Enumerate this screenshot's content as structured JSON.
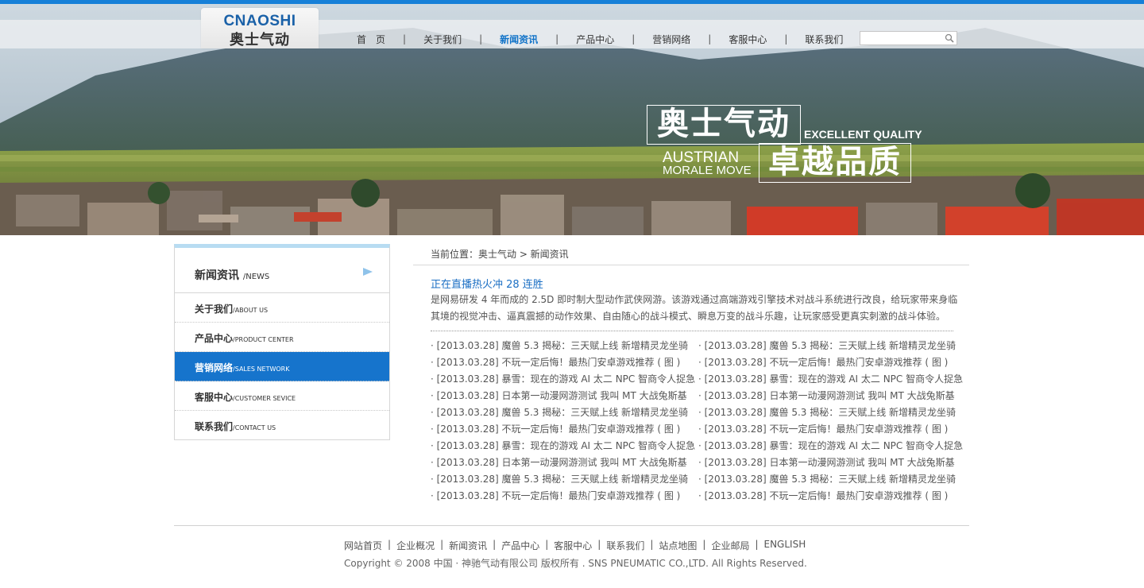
{
  "logo": {
    "en": "CNAOSHI",
    "cn": "奥士气动"
  },
  "nav": {
    "items": [
      "首　页",
      "关于我们",
      "新闻资讯",
      "产品中心",
      "营销网络",
      "客服中心",
      "联系我们"
    ],
    "active_index": 2,
    "separator": "|"
  },
  "search": {
    "placeholder": ""
  },
  "banner": {
    "cn_line1": "奥士气动",
    "cn_line2": "卓越品质",
    "en_line1": "EXCELLENT QUALITY",
    "en_line2": "AUSTRIAN",
    "en_line3": "MORALE MOVE"
  },
  "sidebar": {
    "title": "新闻资讯",
    "title_en": "/NEWS",
    "items": [
      {
        "label": "关于我们",
        "en": "/ABOUT US"
      },
      {
        "label": "产品中心",
        "en": "/PRODUCT CENTER"
      },
      {
        "label": "营销网络",
        "en": "/SALES NETWORK"
      },
      {
        "label": "客服中心",
        "en": "/CUSTOMER SEVICE"
      },
      {
        "label": "联系我们",
        "en": "/CONTACT US"
      }
    ],
    "active_index": 2
  },
  "breadcrumb": "当前位置：奥士气动 > 新闻资讯",
  "article": {
    "title": "正在直播热火冲 28 连胜",
    "description": "是网易研发 4 年而成的 2.5D 即时制大型动作武侠网游。该游戏通过高端游戏引擎技术对战斗系统进行改良，给玩家带来身临其境的视觉冲击、逼真震撼的动作效果、自由随心的战斗模式、瞬息万变的战斗乐趣，让玩家感受更真实刺激的战斗体验。"
  },
  "news": {
    "left": [
      "· [2013.03.28] 魔兽 5.3 揭秘：三天赋上线 新增精灵龙坐骑",
      "· [2013.03.28] 不玩一定后悔！最热门安卓游戏推荐 ( 图 )",
      "· [2013.03.28] 暴雪：现在的游戏 AI 太二 NPC 智商令人捉急",
      "· [2013.03.28] 日本第一动漫网游测试 我叫 MT 大战兔斯基",
      "· [2013.03.28] 魔兽 5.3 揭秘：三天赋上线 新增精灵龙坐骑",
      "· [2013.03.28] 不玩一定后悔！最热门安卓游戏推荐 ( 图 )",
      "· [2013.03.28] 暴雪：现在的游戏 AI 太二 NPC 智商令人捉急",
      "· [2013.03.28] 日本第一动漫网游测试 我叫 MT 大战兔斯基",
      "· [2013.03.28] 魔兽 5.3 揭秘：三天赋上线 新增精灵龙坐骑",
      "· [2013.03.28] 不玩一定后悔！最热门安卓游戏推荐 ( 图 )"
    ],
    "right": [
      "· [2013.03.28] 魔兽 5.3 揭秘：三天赋上线 新增精灵龙坐骑",
      "· [2013.03.28] 不玩一定后悔！最热门安卓游戏推荐 ( 图 )",
      "· [2013.03.28] 暴雪：现在的游戏 AI 太二 NPC 智商令人捉急",
      "· [2013.03.28] 日本第一动漫网游测试 我叫 MT 大战兔斯基",
      "· [2013.03.28] 魔兽 5.3 揭秘：三天赋上线 新增精灵龙坐骑",
      "· [2013.03.28] 不玩一定后悔！最热门安卓游戏推荐 ( 图 )",
      "· [2013.03.28] 暴雪：现在的游戏 AI 太二 NPC 智商令人捉急",
      "· [2013.03.28] 日本第一动漫网游测试 我叫 MT 大战兔斯基",
      "· [2013.03.28] 魔兽 5.3 揭秘：三天赋上线 新增精灵龙坐骑",
      "· [2013.03.28] 不玩一定后悔！最热门安卓游戏推荐 ( 图 )"
    ]
  },
  "footer": {
    "links": [
      "网站首页",
      "企业概况",
      "新闻资讯",
      "产品中心",
      "客服中心",
      "联系我们",
      "站点地图",
      "企业邮局",
      "ENGLISH"
    ],
    "copyright": "Copyright © 2008 中国 · 神驰气动有限公司 版权所有 . SNS PNEUMATIC CO.,LTD. All Rights Reserved."
  },
  "colors": {
    "accent": "#1674cc",
    "topline": "#1680d8",
    "link": "#1b6fc4"
  }
}
